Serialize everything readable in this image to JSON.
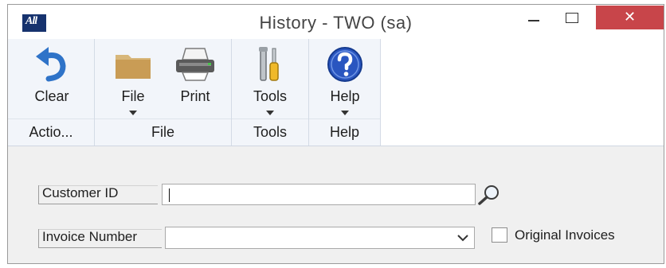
{
  "window": {
    "title": "History  -  TWO (sa)",
    "close_glyph": "✕"
  },
  "ribbon": {
    "groups": [
      {
        "caption": "Actio...",
        "buttons": [
          {
            "label": "Clear",
            "icon": "undo-arrow-icon"
          }
        ]
      },
      {
        "caption": "File",
        "buttons": [
          {
            "label": "File",
            "icon": "folder-icon"
          },
          {
            "label": "Print",
            "icon": "printer-icon"
          }
        ]
      },
      {
        "caption": "Tools",
        "buttons": [
          {
            "label": "Tools",
            "icon": "tools-icon"
          }
        ]
      },
      {
        "caption": "Help",
        "buttons": [
          {
            "label": "Help",
            "icon": "help-icon"
          }
        ]
      }
    ]
  },
  "form": {
    "customer_id": {
      "label": "Customer ID",
      "value": ""
    },
    "invoice_number": {
      "label": "Invoice Number",
      "value": ""
    },
    "original_invoices": {
      "label": "Original Invoices",
      "checked": false
    }
  },
  "colors": {
    "close_button": "#c8454a",
    "ribbon_bg": "#f2f5fa",
    "app_icon": "#16326e",
    "help_blue": "#2a56c0"
  }
}
